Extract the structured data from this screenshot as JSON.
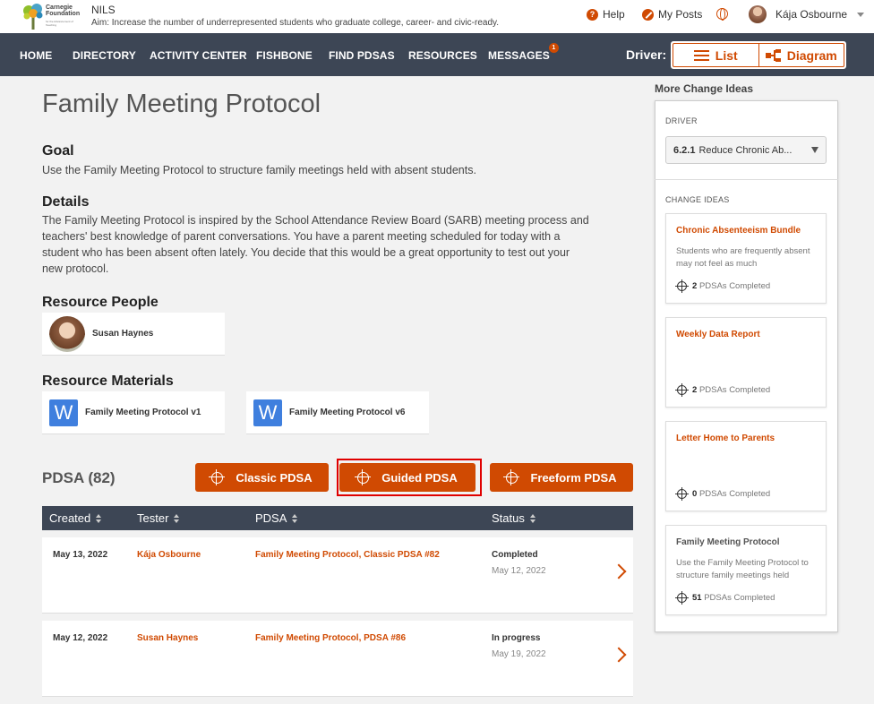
{
  "header": {
    "org_line1": "Carnegie",
    "org_line2": "Foundation",
    "org_sub": "for the Advancement of Teaching",
    "app_name": "NILS",
    "aim": "Aim:  Increase the number of underrepresented students who graduate college, career- and civic-ready.",
    "help_label": "Help",
    "my_posts_label": "My Posts",
    "user_name": "Kája Osbourne"
  },
  "nav": {
    "items": [
      "HOME",
      "DIRECTORY",
      "ACTIVITY CENTER",
      "FISHBONE",
      "FIND PDSAS",
      "RESOURCES",
      "MESSAGES"
    ],
    "messages_badge": "1",
    "driver_label": "Driver:",
    "list_label": "List",
    "diagram_label": "Diagram"
  },
  "page": {
    "title": "Family Meeting Protocol",
    "goal_heading": "Goal",
    "goal_text": "Use the Family Meeting Protocol to structure family meetings held with absent students.",
    "details_heading": "Details",
    "details_line1": "The Family Meeting Protocol is inspired by the School Attendance Review Board (SARB) meeting process and",
    "details_line2": "teachers' best knowledge of parent conversations. You have a parent meeting scheduled for today with a",
    "details_line3": "student who has been absent often lately. You decide that this would be a great opportunity to test out your",
    "details_line4": "new protocol.",
    "people_heading": "Resource People",
    "person_name": "Susan Haynes",
    "materials_heading": "Resource Materials",
    "materials": [
      "Family Meeting Protocol v1",
      "Family Meeting Protocol v6"
    ],
    "word_glyph": "W"
  },
  "pdsa": {
    "count_label": "PDSA (82)",
    "buttons": [
      "Classic PDSA",
      "Guided PDSA",
      "Freeform PDSA"
    ],
    "columns": [
      "Created",
      "Tester",
      "PDSA",
      "Status"
    ],
    "rows": [
      {
        "created": "May 13, 2022",
        "tester": "Kája Osbourne",
        "pdsa": "Family Meeting Protocol, Classic PDSA #82",
        "status": "Completed",
        "status_date": "May 12, 2022"
      },
      {
        "created": "May 12, 2022",
        "tester": "Susan Haynes",
        "pdsa": "Family Meeting Protocol, PDSA #86",
        "status": "In progress",
        "status_date": "May 19, 2022"
      }
    ]
  },
  "sidebar": {
    "title": "More Change Ideas",
    "driver_label": "DRIVER",
    "driver_code": "6.2.1",
    "driver_value": "Reduce Chronic Ab...",
    "change_ideas_label": "CHANGE IDEAS",
    "pdsas_completed_suffix": "PDSAs Completed",
    "cards": [
      {
        "title": "Chronic Absenteeism Bundle",
        "desc": "Students who are frequently absent may not feel as much",
        "count": "2"
      },
      {
        "title": "Weekly Data Report",
        "desc": "",
        "count": "2"
      },
      {
        "title": "Letter Home to Parents",
        "desc": "",
        "count": "0"
      },
      {
        "title": "Family Meeting Protocol",
        "desc": "Use the Family Meeting Protocol to structure family meetings held",
        "count": "51"
      }
    ]
  },
  "colors": {
    "accent": "#d04a02",
    "nav_bg": "#3d4655",
    "highlight": "#e00000"
  }
}
